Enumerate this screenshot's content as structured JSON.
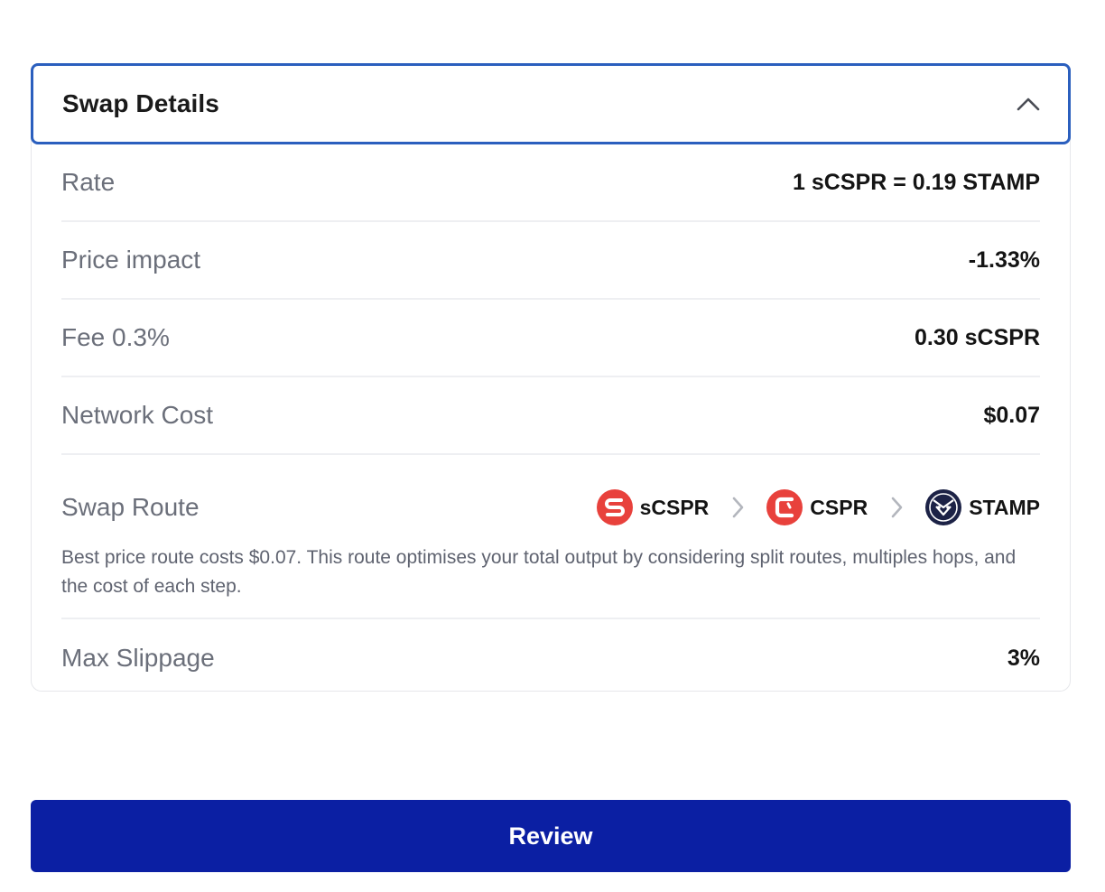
{
  "swap_details": {
    "title": "Swap Details",
    "toggle_icon": "chevron-up-icon",
    "rows": {
      "rate": {
        "label": "Rate",
        "value": "1 sCSPR = 0.19 STAMP"
      },
      "price_impact": {
        "label": "Price impact",
        "value": "-1.33%"
      },
      "fee": {
        "label": "Fee 0.3%",
        "value": "0.30 sCSPR"
      },
      "network_cost": {
        "label": "Network Cost",
        "value": "$0.07"
      },
      "max_slippage": {
        "label": "Max Slippage",
        "value": "3%"
      }
    },
    "swap_route": {
      "label": "Swap Route",
      "tokens": [
        {
          "symbol": "sCSPR",
          "icon": "scspr-token-icon",
          "color": "#e8413c"
        },
        {
          "symbol": "CSPR",
          "icon": "cspr-token-icon",
          "color": "#e8413c"
        },
        {
          "symbol": "STAMP",
          "icon": "stamp-token-icon",
          "color": "#1c2246"
        }
      ],
      "separator_icon": "chevron-right-icon",
      "note": "Best price route costs $0.07. This route optimises your total output by considering split routes, multiples hops, and the cost of each step."
    }
  },
  "review_button": {
    "label": "Review"
  },
  "colors": {
    "accent_border": "#2b5fbe",
    "primary_button": "#0b1fa3",
    "token_red": "#e8413c",
    "token_navy": "#1c2246"
  }
}
